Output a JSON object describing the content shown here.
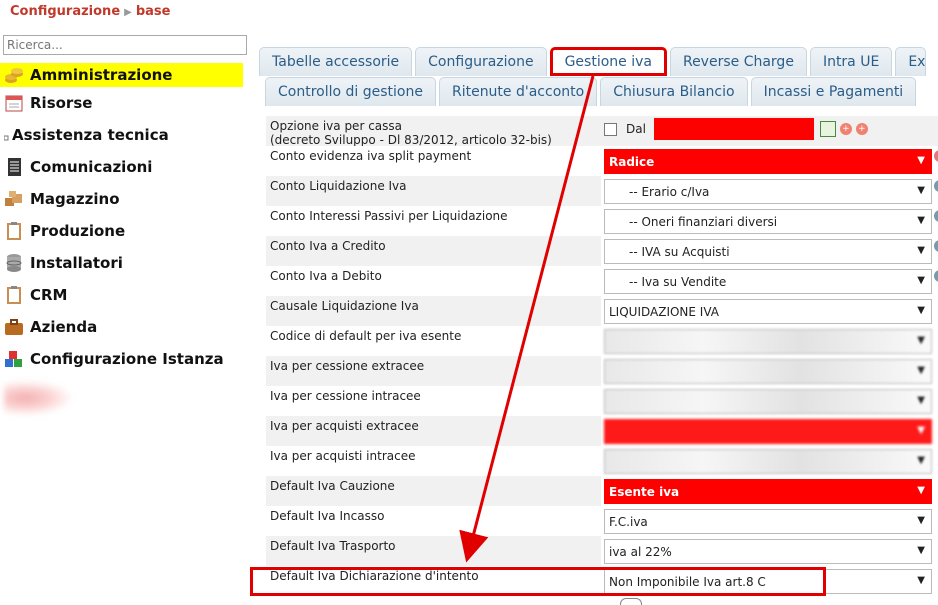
{
  "breadcrumb": {
    "root": "Configurazione",
    "current": "base"
  },
  "search": {
    "placeholder": "Ricerca..."
  },
  "sidebar": {
    "items": [
      {
        "label": "Amministrazione",
        "icon": "coins-icon",
        "active": true
      },
      {
        "label": "Risorse",
        "icon": "calendar-icon",
        "active": false
      },
      {
        "label": "Assistenza tecnica",
        "icon": "dot-icon",
        "active": false
      },
      {
        "label": "Comunicazioni",
        "icon": "document-icon",
        "active": false
      },
      {
        "label": "Magazzino",
        "icon": "boxes-icon",
        "active": false
      },
      {
        "label": "Produzione",
        "icon": "clipboard-icon",
        "active": false
      },
      {
        "label": "Installatori",
        "icon": "database-icon",
        "active": false
      },
      {
        "label": "CRM",
        "icon": "clipboard-icon",
        "active": false
      },
      {
        "label": "Azienda",
        "icon": "briefcase-icon",
        "active": false
      },
      {
        "label": "Configurazione Istanza",
        "icon": "blocks-icon",
        "active": false
      }
    ]
  },
  "tabs": {
    "row1": [
      "Tabelle accessorie",
      "Configurazione",
      "Gestione iva",
      "Reverse Charge",
      "Intra UE",
      "Ex"
    ],
    "row2": [
      "Controllo di gestione",
      "Ritenute d'acconto",
      "Chiusura Bilancio",
      "Incassi e Pagamenti"
    ],
    "active": "Gestione iva"
  },
  "form": {
    "opzione_label_1": "Opzione iva per cassa",
    "opzione_label_2": "(decreto Sviluppo - Dl 83/2012, articolo 32-bis)",
    "dal_label": "Dal",
    "rows": [
      {
        "label": "Conto evidenza iva split payment",
        "value": "Radice"
      },
      {
        "label": "Conto Liquidazione Iva",
        "value": "-- Erario c/Iva"
      },
      {
        "label": "Conto Interessi Passivi per Liquidazione",
        "value": "-- Oneri finanziari diversi"
      },
      {
        "label": "Conto Iva a Credito",
        "value": "-- IVA su Acquisti"
      },
      {
        "label": "Conto Iva a Debito",
        "value": "-- Iva su Vendite"
      },
      {
        "label": "Causale Liquidazione Iva",
        "value": "LIQUIDAZIONE IVA"
      },
      {
        "label": "Codice di default per iva esente",
        "value": ""
      },
      {
        "label": "Iva per cessione extracee",
        "value": ""
      },
      {
        "label": "Iva per cessione intracee",
        "value": ""
      },
      {
        "label": "Iva per acquisti extracee",
        "value": ""
      },
      {
        "label": "Iva per acquisti intracee",
        "value": ""
      },
      {
        "label": "Default Iva Cauzione",
        "value": "Esente iva"
      },
      {
        "label": "Default Iva Incasso",
        "value": "F.C.iva"
      },
      {
        "label": "Default Iva Trasporto",
        "value": "iva al 22%"
      },
      {
        "label": "Default Iva Dichiarazione d'intento",
        "value": "Non Imponibile Iva art.8 C"
      }
    ]
  },
  "colors": {
    "accent": "#e00000",
    "tab_text": "#2b5d88",
    "active_nav": "#ffff00"
  }
}
